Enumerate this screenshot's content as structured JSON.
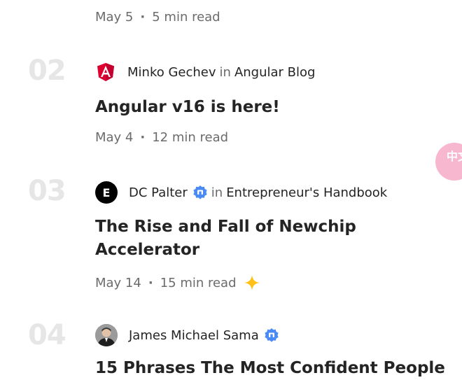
{
  "articles": [
    {
      "number": "",
      "date": "May 5",
      "read_time": "5 min read"
    },
    {
      "number": "02",
      "author": "Minko Gechev",
      "in_label": "in",
      "publication": "Angular Blog",
      "avatar_icon": "angular-logo-icon",
      "title": "Angular v16 is here!",
      "date": "May 4",
      "read_time": "12 min read"
    },
    {
      "number": "03",
      "author": "DC Palter",
      "in_label": "in",
      "publication": "Entrepreneur's Handbook",
      "avatar_icon": "entrepreneurs-handbook-logo-icon",
      "avatar_letter": "E",
      "verified": true,
      "title": "The Rise and Fall of Newchip Accelerator",
      "date": "May 14",
      "read_time": "15 min read",
      "member_only": true
    },
    {
      "number": "04",
      "author": "James Michael Sama",
      "avatar_icon": "user-photo-avatar",
      "verified": true,
      "title": "15 Phrases The Most Confident People"
    }
  ],
  "side_widget": {
    "text": "中文",
    "color": "#f6b7cf"
  },
  "colors": {
    "verified_badge": "#4a8af4",
    "sparkle": "#ffc017",
    "angular_red": "#dd0031",
    "number_gray": "#e6e6e6"
  }
}
